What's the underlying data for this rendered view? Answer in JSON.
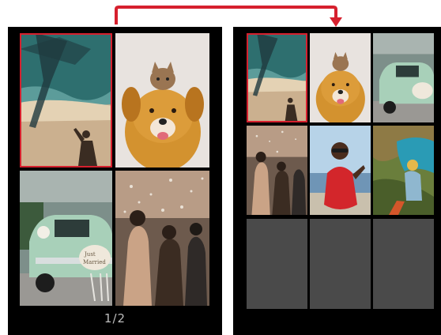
{
  "left_screen": {
    "page_indicator": "1/2",
    "photos": [
      {
        "subject": "beach-shadow",
        "selected": true
      },
      {
        "subject": "dog-and-cat"
      },
      {
        "subject": "wedding-car"
      },
      {
        "subject": "confetti-party"
      }
    ]
  },
  "right_screen": {
    "photos": [
      {
        "subject": "beach-shadow",
        "selected": true
      },
      {
        "subject": "dog-and-cat"
      },
      {
        "subject": "wedding-car"
      },
      {
        "subject": "confetti-party"
      },
      {
        "subject": "woman-red-dress-sunglasses"
      },
      {
        "subject": "hiker-coastal-view"
      }
    ],
    "empty_slots": 3
  },
  "colors": {
    "selection": "#d6202e",
    "arrow": "#d6202e",
    "panel": "#000000",
    "empty_slot": "#4a4a4a"
  }
}
